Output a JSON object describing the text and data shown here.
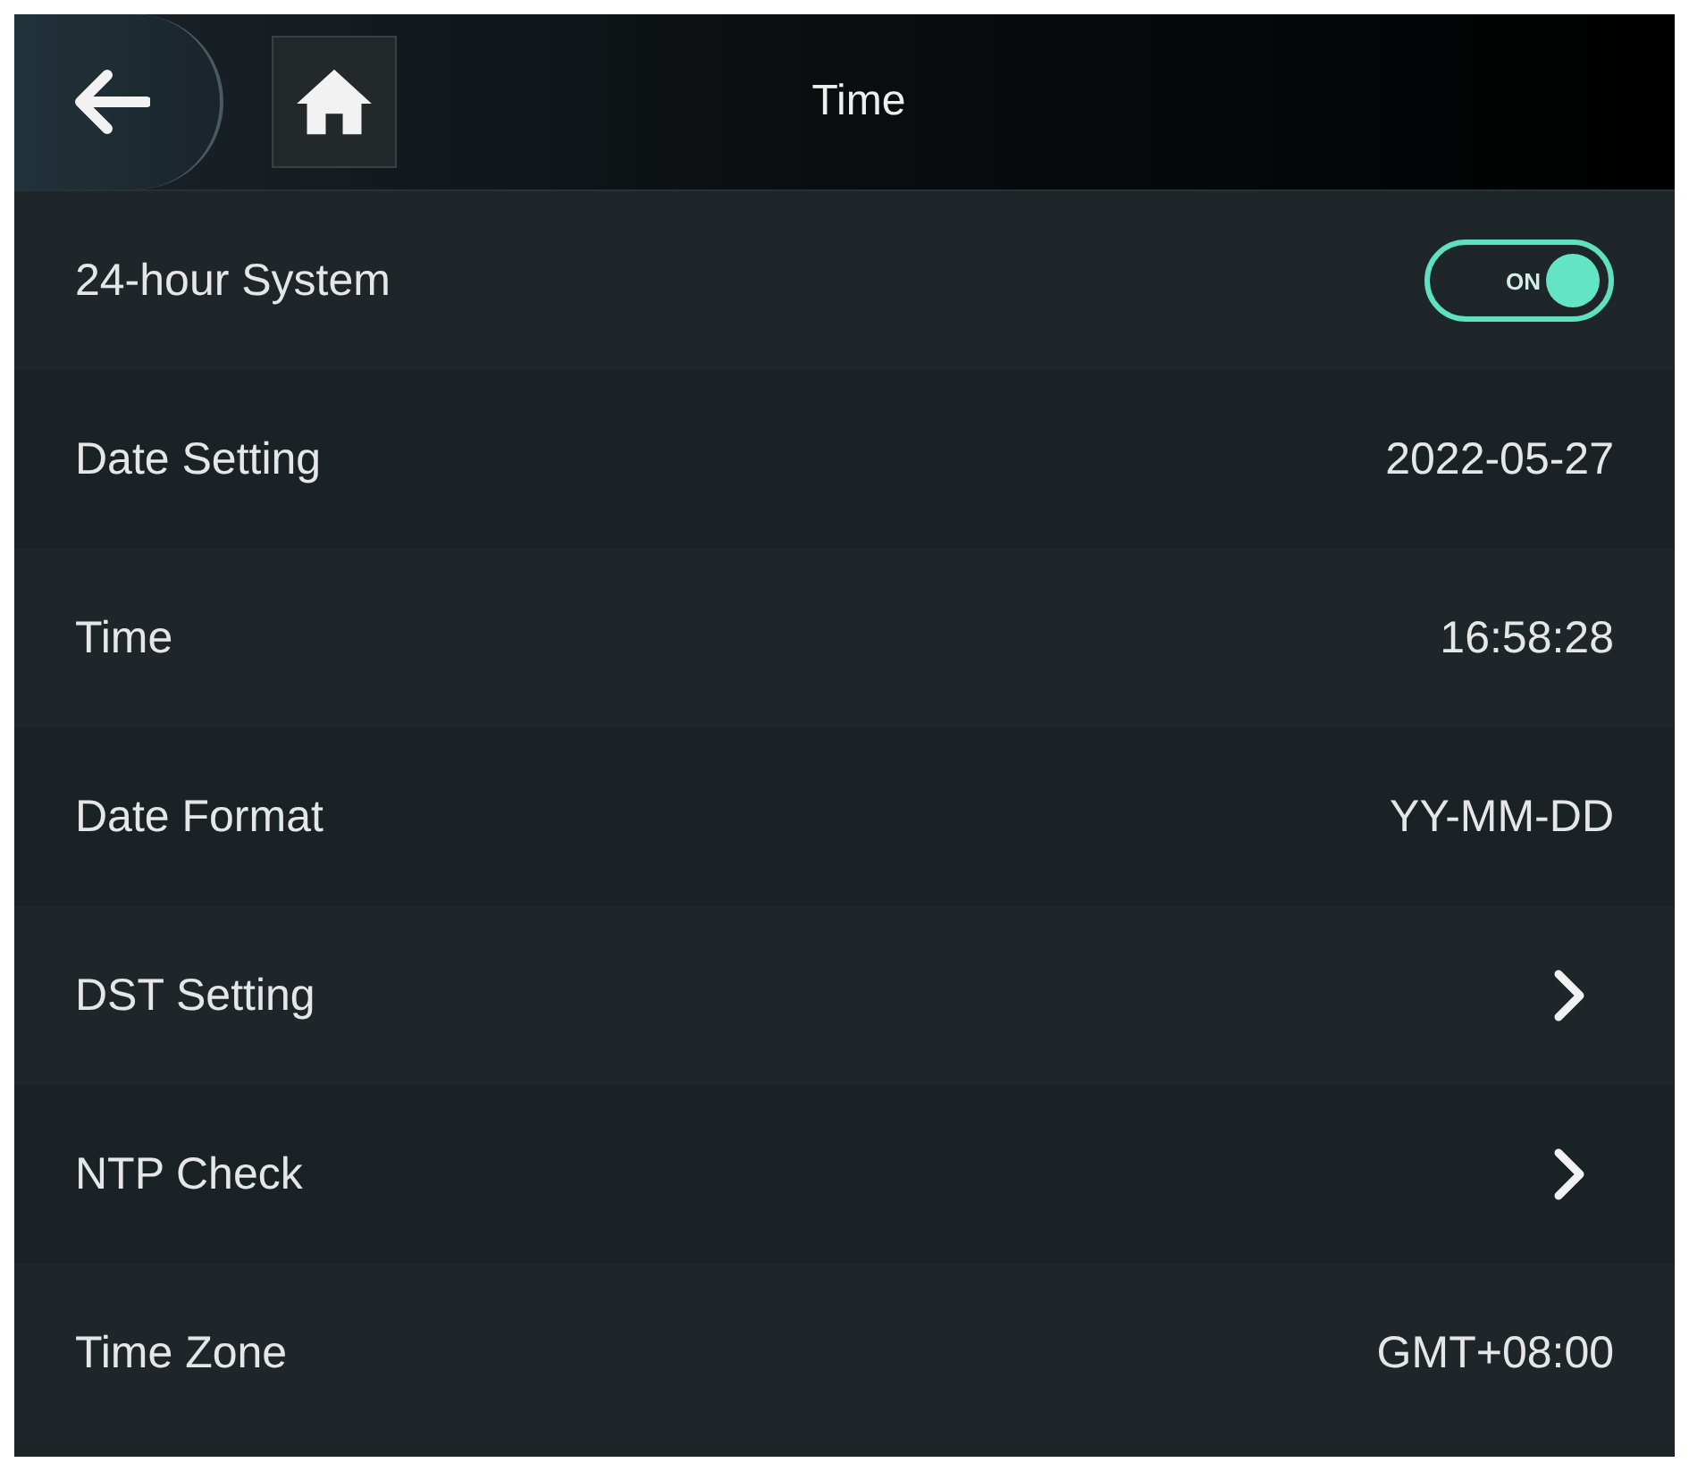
{
  "header": {
    "title": "Time"
  },
  "settings": [
    {
      "kind": "toggle",
      "label": "24-hour System",
      "on": true,
      "state_text": "ON"
    },
    {
      "kind": "value",
      "label": "Date Setting",
      "value": "2022-05-27"
    },
    {
      "kind": "value",
      "label": "Time",
      "value": "16:58:28"
    },
    {
      "kind": "value",
      "label": "Date Format",
      "value": "YY-MM-DD"
    },
    {
      "kind": "link",
      "label": "DST Setting"
    },
    {
      "kind": "link",
      "label": "NTP Check"
    },
    {
      "kind": "value",
      "label": "Time Zone",
      "value": "GMT+08:00"
    }
  ]
}
